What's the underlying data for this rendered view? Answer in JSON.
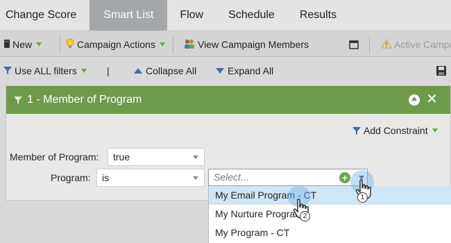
{
  "tabs": [
    {
      "label": "Change Score"
    },
    {
      "label": "Smart List",
      "active": true
    },
    {
      "label": "Flow"
    },
    {
      "label": "Schedule"
    },
    {
      "label": "Results"
    }
  ],
  "toolbar": {
    "new_label": "New",
    "campaign_actions_label": "Campaign Actions",
    "view_members_label": "View Campaign Members",
    "active_label": "Active Campa"
  },
  "filterbar": {
    "use_all_filters": "Use ALL filters",
    "divider": "|",
    "collapse_all": "Collapse All",
    "expand_all": "Expand All"
  },
  "filter": {
    "title": "1 - Member of Program",
    "add_constraint": "Add Constraint",
    "member_label": "Member of Program:",
    "member_value": "true",
    "program_label": "Program:",
    "program_operator": "is",
    "program_placeholder": "Select...",
    "options": [
      "My Email Program - CT",
      "My Nurture Program",
      "My Program - CT"
    ]
  },
  "steps": {
    "one": "1",
    "two": "2"
  },
  "colors": {
    "panel_header": "#6e9b4b",
    "highlight": "#cfe6f7",
    "accent_green": "#6aa84f",
    "accent_blue": "#3f6ea3"
  }
}
